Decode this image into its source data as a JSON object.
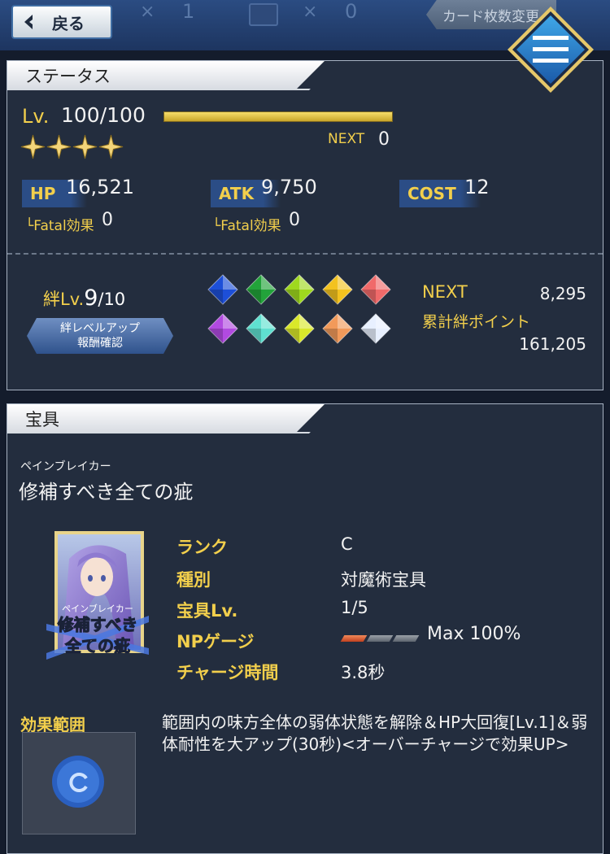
{
  "topbar": {
    "back_label": "戻る",
    "x1": "×",
    "count1": "1",
    "x2": "×",
    "count2": "0",
    "card_count_label": "カード枚数変更"
  },
  "status": {
    "title": "ステータス",
    "lv_label": "Lv.",
    "lv_value": "100/100",
    "stars": 4,
    "next_label": "NEXT",
    "next_value": "0",
    "hp_label": "HP",
    "hp_value": "16,521",
    "atk_label": "ATK",
    "atk_value": "9,750",
    "cost_label": "COST",
    "cost_value": "12",
    "fatal_hp_label": "└Fatal効果",
    "fatal_hp_value": "0",
    "fatal_atk_label": "└Fatal効果",
    "fatal_atk_value": "0",
    "bond_label": "絆Lv.",
    "bond_level": "9",
    "bond_max": "/10",
    "bond_button_line1": "絆レベルアップ",
    "bond_button_line2": "報酬確認",
    "bond_next_label": "NEXT",
    "bond_next_value": "8,295",
    "bond_total_label": "累計絆ポイント",
    "bond_total_value": "161,205",
    "gem_colors": [
      "#1d4fd8",
      "#22a33a",
      "#9fd91e",
      "#f3c21f",
      "#f06a6a",
      "#b14ae0",
      "#5fe0d0",
      "#d9e82a",
      "#f29a5a",
      "#e8f0ff"
    ]
  },
  "np": {
    "title": "宝具",
    "ruby": "ペインブレイカー",
    "name": "修補すべき全ての疵",
    "card_ruby": "ペインブレイカー",
    "card_line1": "修補すべき",
    "card_line2": "全ての疵",
    "rows": [
      {
        "label": "ランク",
        "value": "C"
      },
      {
        "label": "種別",
        "value": "対魔術宝具"
      },
      {
        "label": "宝具Lv.",
        "value": "1/5"
      },
      {
        "label": "NPゲージ",
        "value": ""
      },
      {
        "label": "チャージ時間",
        "value": "3.8秒"
      }
    ],
    "np_gauge_filled": 1,
    "np_gauge_total": 3,
    "np_max": "Max 100%",
    "effect_label": "効果範囲",
    "effect_text": "範囲内の味方全体の弱体状態を解除＆HP大回復[Lv.1]＆弱体耐性を大アップ(30秒)<オーバーチャージで効果UP>"
  }
}
